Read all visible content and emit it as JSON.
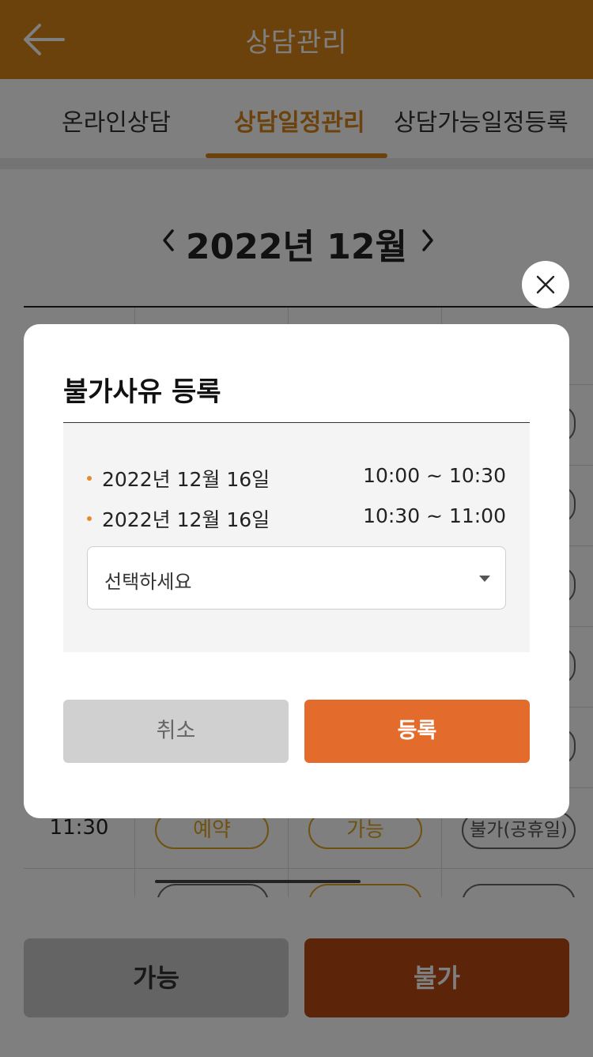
{
  "header": {
    "title": "상담관리",
    "back_icon": "arrow-left-icon"
  },
  "tabs": [
    {
      "label": "온라인상담",
      "active": false
    },
    {
      "label": "상담일정관리",
      "active": true
    },
    {
      "label": "상담가능일정등록",
      "active": false
    }
  ],
  "calendar": {
    "month_label": "2022년 12월",
    "prev_icon": "chevron-left-icon",
    "next_icon": "chevron-right-icon",
    "visible_row": {
      "time": "11:30",
      "cells": [
        "예약",
        "가능",
        "불가(공휴일)"
      ]
    }
  },
  "bottom_bar": {
    "possible_label": "가능",
    "impossible_label": "불가"
  },
  "modal": {
    "title": "불가사유 등록",
    "slots": [
      {
        "date": "2022년 12월 16일",
        "time": "10:00 ~ 10:30"
      },
      {
        "date": "2022년 12월 16일",
        "time": "10:30 ~ 11:00"
      }
    ],
    "select": {
      "value": "선택하세요",
      "icon": "caret-down-icon"
    },
    "cancel_label": "취소",
    "register_label": "등록",
    "close_icon": "close-icon"
  },
  "colors": {
    "header": "#d98518",
    "accent_orange": "#e36b2c",
    "impossible_button": "#b94a14",
    "pill_yellow": "#e0a520"
  }
}
